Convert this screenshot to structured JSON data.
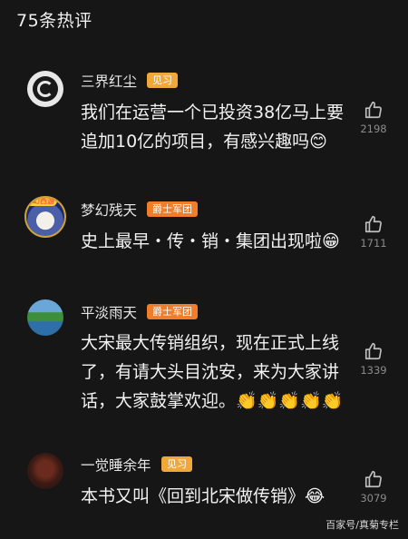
{
  "header": {
    "title": "75条热评"
  },
  "comments": [
    {
      "username": "三界红尘",
      "badge": "见习",
      "text": "我们在运营一个已投资38亿马上要追加10亿的项目，有感兴趣吗😊",
      "likes": "2198",
      "avatar": "swirl-avatar"
    },
    {
      "username": "梦幻残天",
      "badge": "爵士军团",
      "avatar_tag": "梦幻西游",
      "text": "史上最早・传・销・集团出现啦😁",
      "likes": "1711",
      "avatar": "anime-girl-avatar"
    },
    {
      "username": "平淡雨天",
      "badge": "爵士军团",
      "text": "大宋最大传销组织，现在正式上线了，有请大头目沈安，来为大家讲话，大家鼓掌欢迎。👏👏👏👏👏",
      "likes": "1339",
      "avatar": "lake-avatar"
    },
    {
      "username": "一觉睡余年",
      "badge": "见习",
      "text": "本书又叫《回到北宋做传销》😂",
      "likes": "3079",
      "avatar": "tree-avatar"
    }
  ],
  "watermark": "百家号/真菊专栏",
  "colors": {
    "background": "#161616",
    "badge_jianxi": "#f1a83a",
    "badge_juesi": "#ef7d2a"
  },
  "icons": {
    "like": "thumbs-up-icon"
  }
}
